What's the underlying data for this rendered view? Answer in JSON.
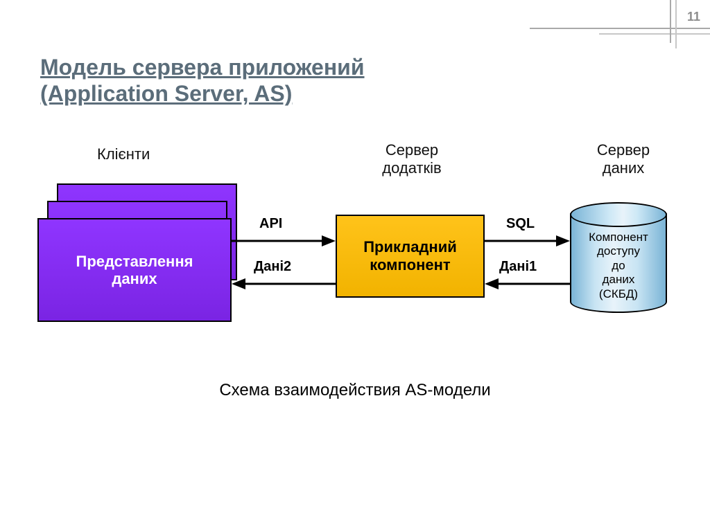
{
  "meta": {
    "page_number": "11"
  },
  "title": {
    "line1": "Модель сервера приложений",
    "line2": "(Application Server, AS)"
  },
  "labels": {
    "clients": "Клієнти",
    "app_server": "Сервер\nдодатків",
    "data_server": "Сервер\nданих"
  },
  "boxes": {
    "client": "Представлення\nданих",
    "app": "Прикладний\nкомпонент",
    "db": "Компонент\nдоступу\nдо\nданих\n(СКБД)"
  },
  "arrows": {
    "api": "API",
    "data2": "Дані2",
    "sql": "SQL",
    "data1": "Дані1"
  },
  "caption": "Схема взаимодействия AS-модели"
}
